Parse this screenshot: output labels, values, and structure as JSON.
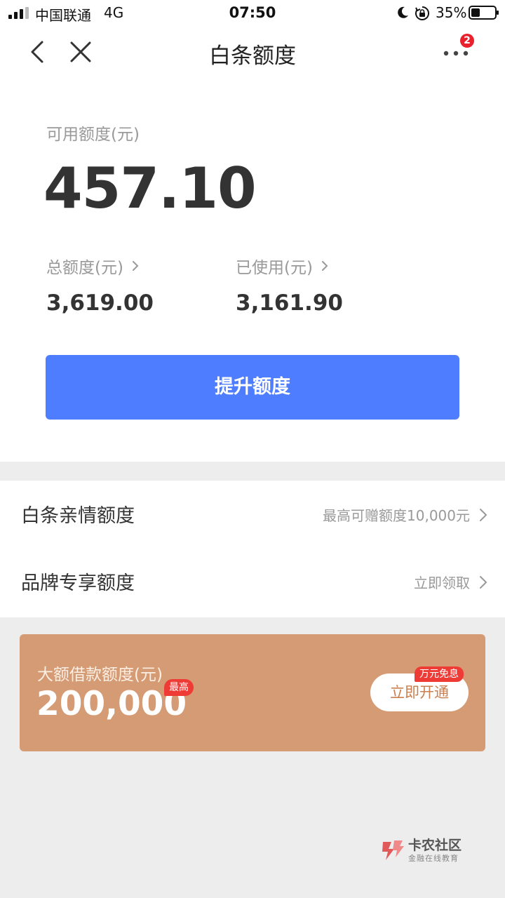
{
  "status_bar": {
    "carrier": "中国联通",
    "network": "4G",
    "time": "07:50",
    "battery_percent": "35%",
    "icons": [
      "signal-icon",
      "moon-icon",
      "rotation-lock-icon",
      "battery-icon"
    ]
  },
  "nav": {
    "title": "白条额度",
    "badge_count": "2",
    "icons": [
      "back-icon",
      "close-icon",
      "more-icon"
    ]
  },
  "credit": {
    "available_label": "可用额度(元)",
    "available_value": "457.10",
    "total_label": "总额度(元)",
    "total_value": "3,619.00",
    "used_label": "已使用(元)",
    "used_value": "3,161.90",
    "raise_button": "提升额度"
  },
  "list": [
    {
      "title": "白条亲情额度",
      "hint": "最高可赠额度10,000元"
    },
    {
      "title": "品牌专享额度",
      "hint": "立即领取"
    }
  ],
  "loan": {
    "label": "大额借款额度(元)",
    "amount": "200,000",
    "max_tag": "最高",
    "button": "立即开通",
    "free_tag": "万元免息"
  },
  "watermark": {
    "name": "卡农社区",
    "subtitle": "金融在线教育"
  },
  "colors": {
    "primary": "#4e7eff",
    "banner": "#d49b74",
    "badge": "#e8212d",
    "tag": "#ef3b36",
    "background": "#ededed"
  }
}
